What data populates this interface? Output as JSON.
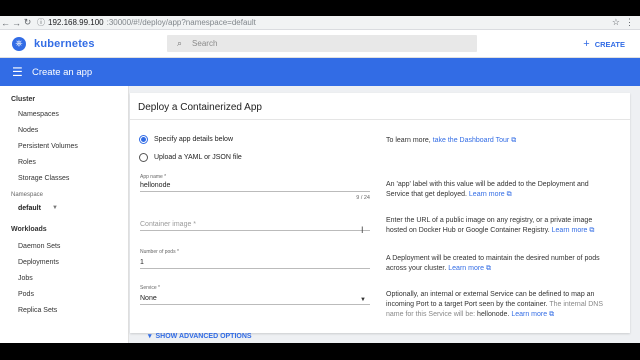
{
  "browser": {
    "url_host": "192.168.99.100",
    "url_path": ":30000/#!/deploy/app?namespace=default"
  },
  "header": {
    "brand": "kubernetes",
    "search_placeholder": "Search",
    "create_label": "CREATE"
  },
  "actionbar": {
    "title": "Create an app"
  },
  "sidebar": {
    "cluster_heading": "Cluster",
    "cluster_items": [
      "Namespaces",
      "Nodes",
      "Persistent Volumes",
      "Roles",
      "Storage Classes"
    ],
    "namespace_label": "Namespace",
    "namespace_value": "default",
    "workloads_heading": "Workloads",
    "workload_items": [
      "Daemon Sets",
      "Deployments",
      "Jobs",
      "Pods",
      "Replica Sets"
    ]
  },
  "card": {
    "title": "Deploy a Containerized App",
    "radio_specify": "Specify app details below",
    "radio_upload": "Upload a YAML or JSON file",
    "app_name_label": "App name *",
    "app_name_value": "hellonode",
    "app_name_counter": "9 / 24",
    "container_image_placeholder": "Container image *",
    "pods_label": "Number of pods *",
    "pods_value": "1",
    "service_label": "Service *",
    "service_value": "None",
    "advanced_label": "SHOW ADVANCED OPTIONS"
  },
  "help": {
    "tour_prefix": "To learn more, ",
    "tour_link": "take the Dashboard Tour",
    "app_label_text": "An 'app' label with this value will be added to the Deployment and Service that get deployed.",
    "image_text": "Enter the URL of a public image on any registry, or a private image hosted on Docker Hub or Google Container Registry.",
    "pods_text": "A Deployment will be created to maintain the desired number of pods across your cluster.",
    "service_text": "Optionally, an internal or external Service can be defined to map an incoming Port to a target Port seen by the container.",
    "service_dns_text": "The internal DNS name for this Service will be:",
    "service_dns_value": "hellonode",
    "learn_more": "Learn more"
  },
  "colors": {
    "accent": "#326ce5"
  }
}
